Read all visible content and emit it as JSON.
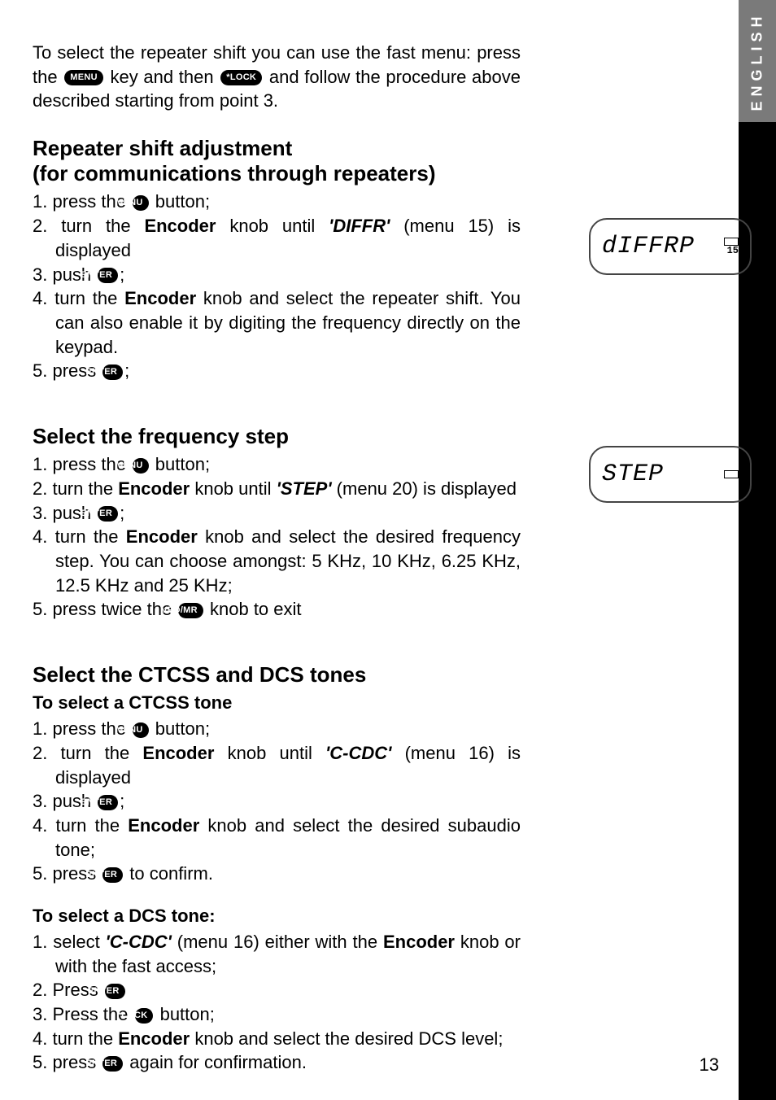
{
  "sideTab": "ENGLISH",
  "keys": {
    "menu": "MENU",
    "lock": "*LOCK",
    "enter": "ENTER",
    "vfomr": "VFO/MR"
  },
  "intro": {
    "p1a": "To select the repeater shift you can use the fast menu: press the ",
    "p1b": " key and then ",
    "p1c": " and follow the procedure above described starting from point 3."
  },
  "section1": {
    "title1": "Repeater shift adjustment",
    "title2": "(for communications through repeaters)",
    "s1a": "1. press the ",
    "s1b": " button;",
    "s2a": "2. turn the ",
    "s2b": "Encoder",
    "s2c": " knob until ",
    "s2d": "'DIFFR'",
    "s2e": " (menu 15) is displayed",
    "s3a": "3. push ",
    "s3b": ";",
    "s4a": "4. turn the ",
    "s4b": "Encoder",
    "s4c": " knob and select the repeater shift. You can also enable it by digiting the frequency directly on the keypad.",
    "s5a": "5. press ",
    "s5b": ";"
  },
  "lcd1": {
    "text": "dIFFRP",
    "badge": "15"
  },
  "section2": {
    "title": "Select the frequency step",
    "s1a": "1. press the ",
    "s1b": " button;",
    "s2a": "2. turn the ",
    "s2b": "Encoder",
    "s2c": " knob until ",
    "s2d": "'STEP'",
    "s2e": " (menu 20) is displayed",
    "s3a": "3. push ",
    "s3b": ";",
    "s4a": "4. turn the ",
    "s4b": "Encoder",
    "s4c": " knob and select the desired frequency step. You can choose amongst: 5 KHz, 10 KHz, 6.25 KHz, 12.5 KHz and 25 KHz;",
    "s5a": "5. press twice the ",
    "s5b": " knob to exit"
  },
  "lcd2": {
    "text": "STEP"
  },
  "section3": {
    "title": "Select the CTCSS and DCS tones",
    "sub1": "To select a CTCSS tone",
    "a1a": "1. press the ",
    "a1b": " button;",
    "a2a": "2. turn the ",
    "a2b": "Encoder",
    "a2c": " knob until ",
    "a2d": "'C-CDC'",
    "a2e": " (menu 16) is displayed",
    "a3a": "3. push ",
    "a3b": ";",
    "a4a": "4. turn the ",
    "a4b": "Encoder",
    "a4c": " knob and select the desired subaudio tone;",
    "a5a": "5. press ",
    "a5b": " to confirm.",
    "sub2": "To select a DCS tone:",
    "b1a": "1. select ",
    "b1b": "'C-CDC'",
    "b1c": " (menu 16) either with the ",
    "b1d": "Encoder",
    "b1e": " knob or with the fast access;",
    "b2a": "2. Press ",
    "b3a": "3. Press the ",
    "b3b": " button;",
    "b4a": "4. turn the ",
    "b4b": "Encoder",
    "b4c": " knob and select the desired DCS level;",
    "b5a": "5. press ",
    "b5b": " again for confirmation."
  },
  "pageNumber": "13"
}
